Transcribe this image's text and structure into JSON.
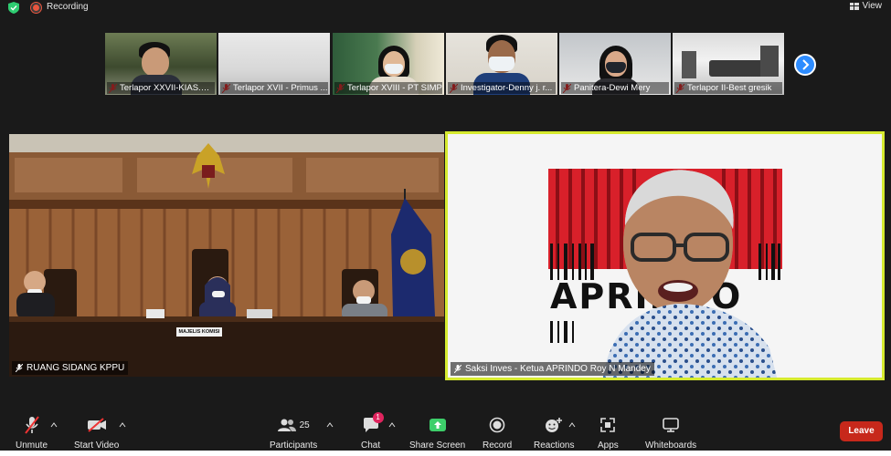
{
  "topbar": {
    "recording_label": "Recording",
    "view_label": "View"
  },
  "thumbnails": [
    {
      "name": "Terlapor XXVII-KIAS.St..."
    },
    {
      "name": "Terlapor XVII - Primus ..."
    },
    {
      "name": "Terlapor XVIII - PT SIMP"
    },
    {
      "name": "Investigator-Denny  j. r..."
    },
    {
      "name": "Panitera-Dewi Mery"
    },
    {
      "name": "Terlapor II-Best gresik"
    }
  ],
  "main_videos": {
    "left_label": "RUANG SIDANG KPPU",
    "left_sign": "MAJELIS KOMISI",
    "right_label": "Saksi Inves - Ketua APRINDO Roy N Mandey",
    "right_logo_text": "APRINDO"
  },
  "toolbar": {
    "unmute": "Unmute",
    "start_video": "Start Video",
    "participants": "Participants",
    "participants_count": "25",
    "chat": "Chat",
    "chat_badge": "1",
    "share_screen": "Share Screen",
    "record": "Record",
    "reactions": "Reactions",
    "apps": "Apps",
    "whiteboards": "Whiteboards",
    "leave": "Leave"
  },
  "colors": {
    "active_speaker_border": "#d6ea2f",
    "share_green": "#3dcf6a",
    "leave_red": "#c7281b",
    "accent_blue": "#2d8cff",
    "chat_badge": "#e0245e"
  }
}
